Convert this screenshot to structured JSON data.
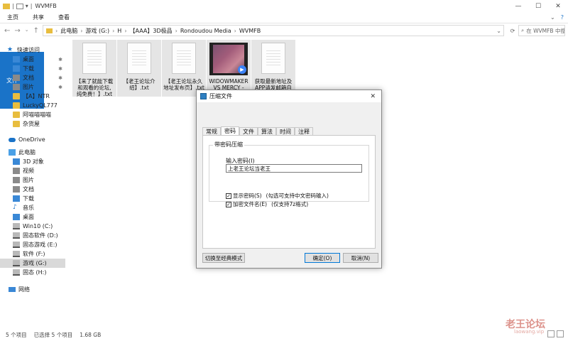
{
  "window": {
    "title": "WVMFB"
  },
  "ribbon": {
    "file": "文件",
    "home": "主页",
    "share": "共享",
    "view": "查看"
  },
  "address": {
    "crumbs": [
      "此电脑",
      "游戏 (G:)",
      "H",
      "【AAA】3D极品",
      "Rondoudou Media",
      "WVMFB"
    ],
    "search_placeholder": "在 WVMFB 中搜索"
  },
  "nav": {
    "quick_access": "快速访问",
    "items": [
      {
        "label": "桌面",
        "icon": "desktop-icon"
      },
      {
        "label": "下载",
        "icon": "download-icon"
      },
      {
        "label": "文档",
        "icon": "documents-icon"
      },
      {
        "label": "图片",
        "icon": "pictures-icon"
      },
      {
        "label": "【A】NTR",
        "icon": "folder-icon"
      },
      {
        "label": "LuckyQL777",
        "icon": "folder-icon"
      },
      {
        "label": "阿喵喵喵喵",
        "icon": "folder-icon"
      },
      {
        "label": "杂货屋",
        "icon": "folder-icon"
      }
    ],
    "onedrive": "OneDrive",
    "this_pc": "此电脑",
    "pc_items": [
      {
        "label": "3D 对象",
        "icon": "3d-objects-icon"
      },
      {
        "label": "视频",
        "icon": "videos-icon"
      },
      {
        "label": "图片",
        "icon": "pictures-icon"
      },
      {
        "label": "文档",
        "icon": "documents-icon"
      },
      {
        "label": "下载",
        "icon": "download-icon"
      },
      {
        "label": "音乐",
        "icon": "music-icon"
      },
      {
        "label": "桌面",
        "icon": "desktop-icon"
      },
      {
        "label": "Win10 (C:)",
        "icon": "drive-icon"
      },
      {
        "label": "固态软件 (D:)",
        "icon": "drive-icon"
      },
      {
        "label": "固态游戏 (E:)",
        "icon": "drive-icon"
      },
      {
        "label": "软件 (F:)",
        "icon": "drive-icon"
      },
      {
        "label": "游戏 (G:)",
        "icon": "drive-icon"
      },
      {
        "label": "固态 (H:)",
        "icon": "drive-icon"
      }
    ],
    "network": "网络"
  },
  "files": [
    {
      "l1": "【来了就能下载",
      "l2": "和观看的论坛,",
      "l3": "纯免费！】.txt"
    },
    {
      "l1": "【老王论坛介",
      "l2": "绍】.txt",
      "l3": ""
    },
    {
      "l1": "【老王论坛永久",
      "l2": "地址发布页】.txt",
      "l3": ""
    },
    {
      "l1": "WIDOWMAKER",
      "l2": "VS MERCY -",
      "l3": ""
    },
    {
      "l1": "获取最新地址及",
      "l2": "APP请发邮箱自",
      "l3": ""
    }
  ],
  "dialog": {
    "title": "压缩文件",
    "tabs": [
      "常规",
      "密码",
      "文件",
      "算法",
      "时间",
      "注释"
    ],
    "group_title": "带密码压缩",
    "password_label": "输入密码(I)",
    "password_value": "上老王论坛当老王",
    "show_password": "显示密码(S)",
    "show_password_hint": "(勾选可支持中文密码输入)",
    "encrypt_names": "加密文件名(E)",
    "encrypt_names_hint": "(仅支持7z格式)",
    "switch_mode": "切换至经典模式",
    "ok": "确定(O)",
    "cancel": "取消(N)"
  },
  "status": {
    "count": "5 个项目",
    "selected": "已选择 5 个项目",
    "size": "1.68 GB"
  },
  "watermark": {
    "text": "老王论坛",
    "sub": "laowang.vip"
  }
}
